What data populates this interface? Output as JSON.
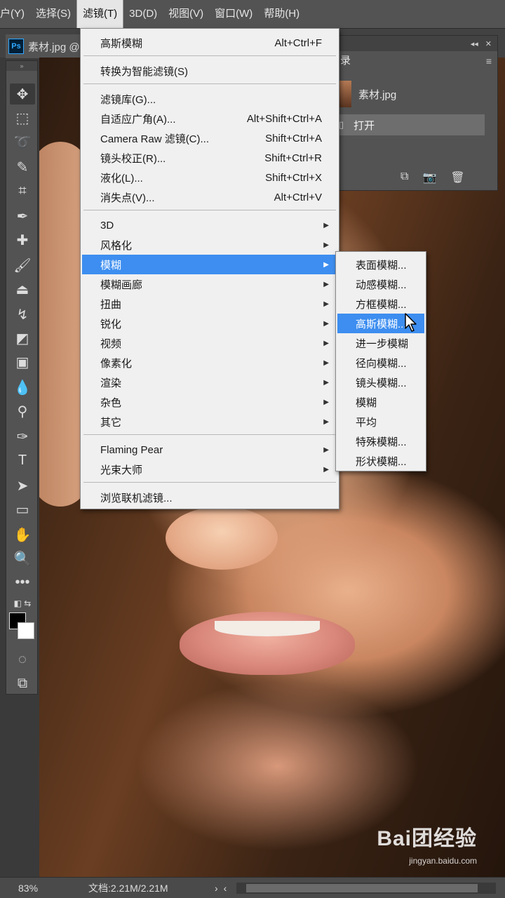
{
  "menubar": {
    "items": [
      "户(Y)",
      "选择(S)",
      "滤镜(T)",
      "3D(D)",
      "视图(V)",
      "窗口(W)",
      "帮助(H)"
    ],
    "partial_first": " (Y)"
  },
  "document": {
    "tab_label": "素材.jpg @",
    "ps_badge": "Ps"
  },
  "filter_menu": {
    "last_filter": {
      "label": "高斯模糊",
      "shortcut": "Alt+Ctrl+F"
    },
    "smart": "转换为智能滤镜(S)",
    "group2": [
      {
        "label": "滤镜库(G)...",
        "shortcut": ""
      },
      {
        "label": "自适应广角(A)...",
        "shortcut": "Alt+Shift+Ctrl+A"
      },
      {
        "label": "Camera Raw 滤镜(C)...",
        "shortcut": "Shift+Ctrl+A"
      },
      {
        "label": "镜头校正(R)...",
        "shortcut": "Shift+Ctrl+R"
      },
      {
        "label": "液化(L)...",
        "shortcut": "Shift+Ctrl+X"
      },
      {
        "label": "消失点(V)...",
        "shortcut": "Alt+Ctrl+V"
      }
    ],
    "group3": [
      "3D",
      "风格化",
      "模糊",
      "模糊画廊",
      "扭曲",
      "锐化",
      "视频",
      "像素化",
      "渲染",
      "杂色",
      "其它"
    ],
    "group4": [
      "Flaming Pear",
      "光束大师"
    ],
    "browse": "浏览联机滤镜..."
  },
  "blur_submenu": {
    "items": [
      "表面模糊...",
      "动感模糊...",
      "方框模糊...",
      "高斯模糊...",
      "进一步模糊",
      "径向模糊...",
      "镜头模糊...",
      "模糊",
      "平均",
      "特殊模糊...",
      "形状模糊..."
    ]
  },
  "history_panel": {
    "title": "录",
    "snapshot": "素材.jpg",
    "state": "打开"
  },
  "status": {
    "zoom": "83%",
    "doc": "文档:2.21M/2.21M"
  },
  "watermark": {
    "logo": "Bai团经验",
    "url": "jingyan.baidu.com"
  },
  "colors": {
    "highlight": "#3d8ef0",
    "menu_bg": "#f0f0f0",
    "chrome": "#535353"
  }
}
